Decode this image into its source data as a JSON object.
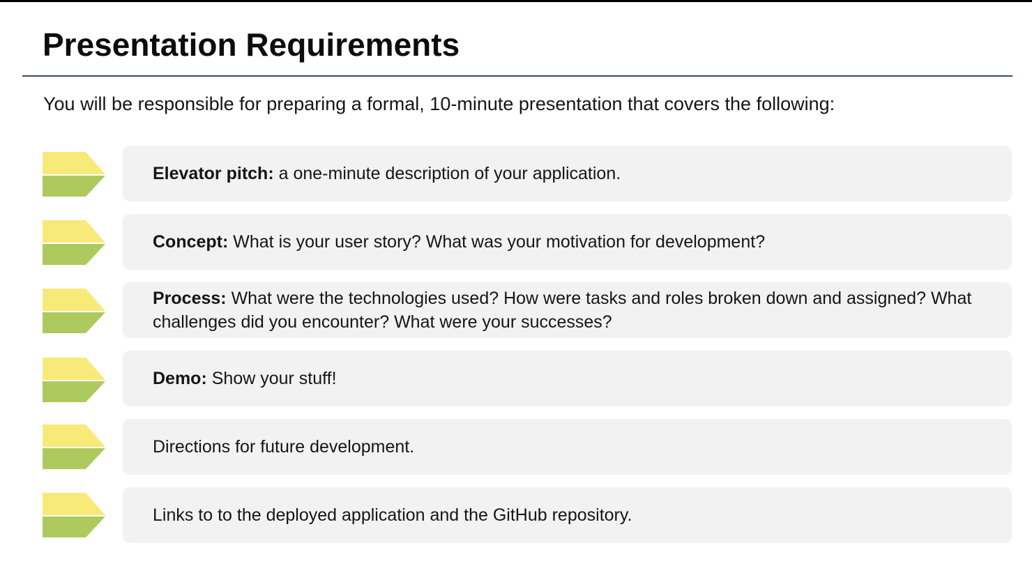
{
  "slide": {
    "title": "Presentation Requirements",
    "intro": "You will be responsible for preparing a formal, 10-minute presentation that covers the following:",
    "marker_colors": {
      "top": "#f7ea78",
      "bottom": "#aec95e"
    },
    "card_color": "#f2f2f2",
    "items": [
      {
        "lead": "Elevator pitch:",
        "text": " a one-minute description of your application."
      },
      {
        "lead": "Concept:",
        "text": " What is your user story? What was your motivation for development?"
      },
      {
        "lead": "Process:",
        "text": " What were the technologies used? How were tasks and roles broken down and assigned? What challenges did you encounter? What were your successes?"
      },
      {
        "lead": "Demo:",
        "text": " Show your stuff!"
      },
      {
        "lead": "",
        "text": "Directions for future development."
      },
      {
        "lead": "",
        "text": "Links to to the deployed application and the GitHub repository."
      }
    ]
  }
}
